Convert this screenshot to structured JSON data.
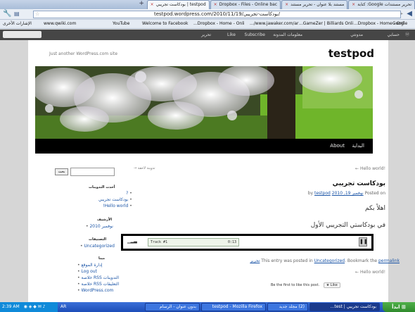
{
  "browser": {
    "tabs": [
      {
        "label": "تحرير مستندات Google: كتابة",
        "active": false
      },
      {
        "label": "مستند بلا عنوان - تحرير مستند",
        "active": false
      },
      {
        "label": "Dropbox - Files - Online bac",
        "active": false
      },
      {
        "label": "testpod | بودكاست تجريبي",
        "active": true
      }
    ],
    "url": "testpod.wordpress.com/2010/11/19/بودكاست-تجريبي/"
  },
  "bookmarks": [
    "www.qwiki.com",
    "YouTube",
    "Welcome to Facebook",
    "Dropbox - Home - Onli...",
    "www.jawaker.com/ar/...",
    "GameZer | Billiards Onli...",
    "Dropbox - Home - Onli...",
    "Google",
    "الإشارات الأخرى"
  ],
  "adminbar": {
    "items": [
      "حسابي",
      "مدونتي",
      "معلومات المدونة",
      "Subscribe",
      "Like",
      "تحرير"
    ]
  },
  "site": {
    "title": "testpod",
    "tagline": "Just another WordPress.com site",
    "menu": [
      "البداية",
      "About"
    ]
  },
  "post": {
    "nav_prev": "← Hello world!",
    "nav_next": "تدوينة لاحقة →",
    "title": "بودكاست تجريبي",
    "posted_on": "Posted on",
    "date": "نوفمبر 19, 2010",
    "by": "by",
    "author": "testpod",
    "para1": "اهلاً بكم",
    "para2": "في بودكاستي التجريبي الأول",
    "player_track": "Track #1",
    "player_time": "0:13",
    "meta_prefix": "This entry was posted in",
    "category": "Uncategorized",
    "meta_middle": ". Bookmark the",
    "permalink": "permalink",
    "edit": "تحرير",
    "footer_nav": "← Hello world!",
    "like_text": "Be the first to like this post.",
    "like_btn": "Like"
  },
  "sidebar": {
    "search_btn": "بحث",
    "recent_title": "أحدث التدوينات",
    "recent": [
      "?",
      "بودكاست تجريبي",
      "Hello world!"
    ],
    "archives_title": "الأرشيف",
    "archives": [
      "نوفمبر 2010"
    ],
    "categories_title": "التصنيفات",
    "categories": [
      "Uncategorized"
    ],
    "meta_title": "ميتا",
    "meta": [
      "إدارة الموقع",
      "Log out",
      "خلاصة RSS التدوينات",
      "خلاصة RSS التعليقات",
      "WordPress.com"
    ]
  },
  "taskbar": {
    "start": "ابدأ",
    "items": [
      "بودكاست تجريبي | test...",
      "(2) مجلد جديد",
      "testpod - Mozilla Firefox",
      "بدون عنوان - الرسام"
    ],
    "clock": "2:39 AM",
    "lang": "AR"
  }
}
